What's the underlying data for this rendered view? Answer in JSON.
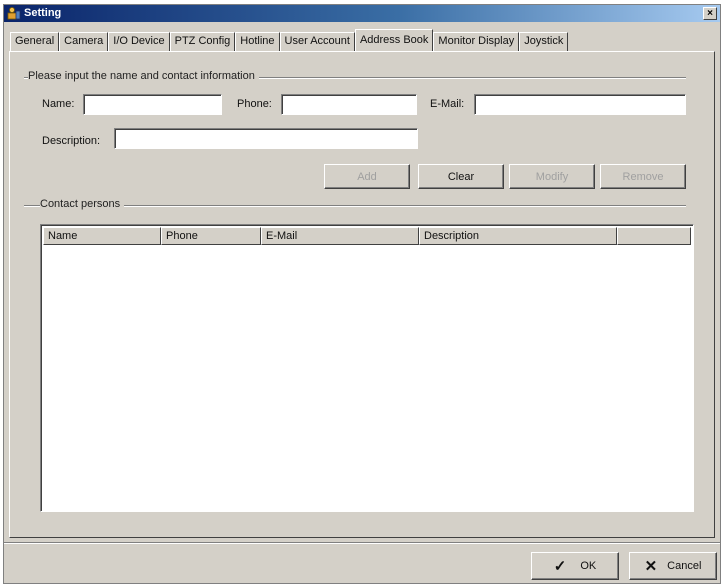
{
  "window": {
    "title": "Setting",
    "close_glyph": "×",
    "icon": "settings-app-icon"
  },
  "tabs": [
    {
      "label": "General",
      "active": false
    },
    {
      "label": "Camera",
      "active": false
    },
    {
      "label": "I/O Device",
      "active": false
    },
    {
      "label": "PTZ Config",
      "active": false
    },
    {
      "label": "Hotline",
      "active": false
    },
    {
      "label": "User Account",
      "active": false
    },
    {
      "label": "Address Book",
      "active": true
    },
    {
      "label": "Monitor Display",
      "active": false
    },
    {
      "label": "Joystick",
      "active": false
    }
  ],
  "input_group": {
    "label": "Please input the name and contact information",
    "name_label": "Name:",
    "name_value": "",
    "phone_label": "Phone:",
    "phone_value": "",
    "email_label": "E-Mail:",
    "email_value": "",
    "description_label": "Description:",
    "description_value": ""
  },
  "actions": {
    "add": {
      "label": "Add",
      "enabled": false
    },
    "clear": {
      "label": "Clear",
      "enabled": true
    },
    "modify": {
      "label": "Modify",
      "enabled": false
    },
    "remove": {
      "label": "Remove",
      "enabled": false
    }
  },
  "contacts": {
    "label": "Contact persons",
    "columns": [
      "Name",
      "Phone",
      "E-Mail",
      "Description"
    ],
    "rows": []
  },
  "footer": {
    "ok_label": "OK",
    "ok_icon": "checkmark-icon",
    "cancel_label": "Cancel",
    "cancel_icon": "x-cross-icon"
  }
}
